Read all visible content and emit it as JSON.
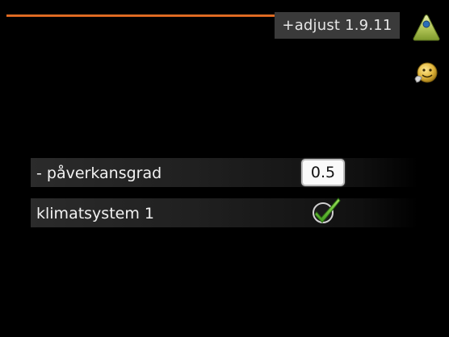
{
  "header": {
    "title": "+adjust 1.9.11",
    "accent_color": "#f07a2a"
  },
  "side_icons": [
    {
      "name": "home-icon"
    },
    {
      "name": "help-face-icon"
    }
  ],
  "rows": [
    {
      "label": "- påverkansgrad",
      "value": "0.5"
    },
    {
      "label": "klimatsystem 1",
      "checked": true,
      "icon": "checkmark-icon"
    }
  ]
}
